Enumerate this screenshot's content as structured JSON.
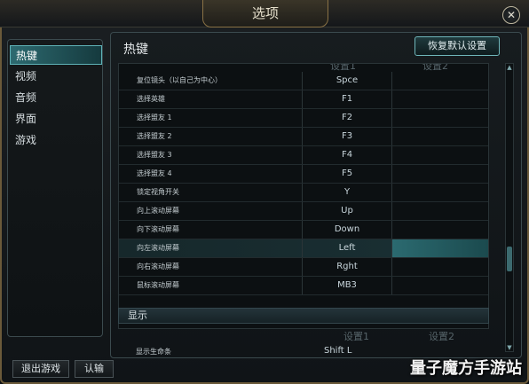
{
  "window": {
    "title": "选项",
    "close_glyph": "✕"
  },
  "sidebar": {
    "items": [
      {
        "label": "热键",
        "active": true
      },
      {
        "label": "视频",
        "active": false
      },
      {
        "label": "音频",
        "active": false
      },
      {
        "label": "界面",
        "active": false
      },
      {
        "label": "游戏",
        "active": false
      }
    ]
  },
  "main": {
    "title": "热键",
    "restore_label": "恢复默认设置",
    "col1_header": "设置1",
    "col2_header": "设置2",
    "rows": [
      {
        "label": "复位镜头（以自己为中心）",
        "key1": "Spce",
        "key2": ""
      },
      {
        "label": "选择英雄",
        "key1": "F1",
        "key2": ""
      },
      {
        "label": "选择盟友 1",
        "key1": "F2",
        "key2": ""
      },
      {
        "label": "选择盟友 2",
        "key1": "F3",
        "key2": ""
      },
      {
        "label": "选择盟友 3",
        "key1": "F4",
        "key2": ""
      },
      {
        "label": "选择盟友 4",
        "key1": "F5",
        "key2": ""
      },
      {
        "label": "锁定视角开关",
        "key1": "Y",
        "key2": ""
      },
      {
        "label": "向上滚动屏幕",
        "key1": "Up",
        "key2": ""
      },
      {
        "label": "向下滚动屏幕",
        "key1": "Down",
        "key2": ""
      },
      {
        "label": "向左滚动屏幕",
        "key1": "Left",
        "key2": ""
      },
      {
        "label": "向右滚动屏幕",
        "key1": "Rght",
        "key2": ""
      },
      {
        "label": "鼠标滚动屏幕",
        "key1": "MB3",
        "key2": ""
      }
    ],
    "display_section": {
      "title": "显示",
      "col1_header": "设置1",
      "col2_header": "设置2",
      "row": {
        "label": "显示生命条",
        "key1": "Shift L"
      }
    }
  },
  "footer": {
    "quit_label": "退出游戏",
    "surrender_label": "认输"
  },
  "watermark": "量子魔方手游站",
  "colors": {
    "accent": "#2d6a70",
    "border_gold": "#8a7245"
  }
}
